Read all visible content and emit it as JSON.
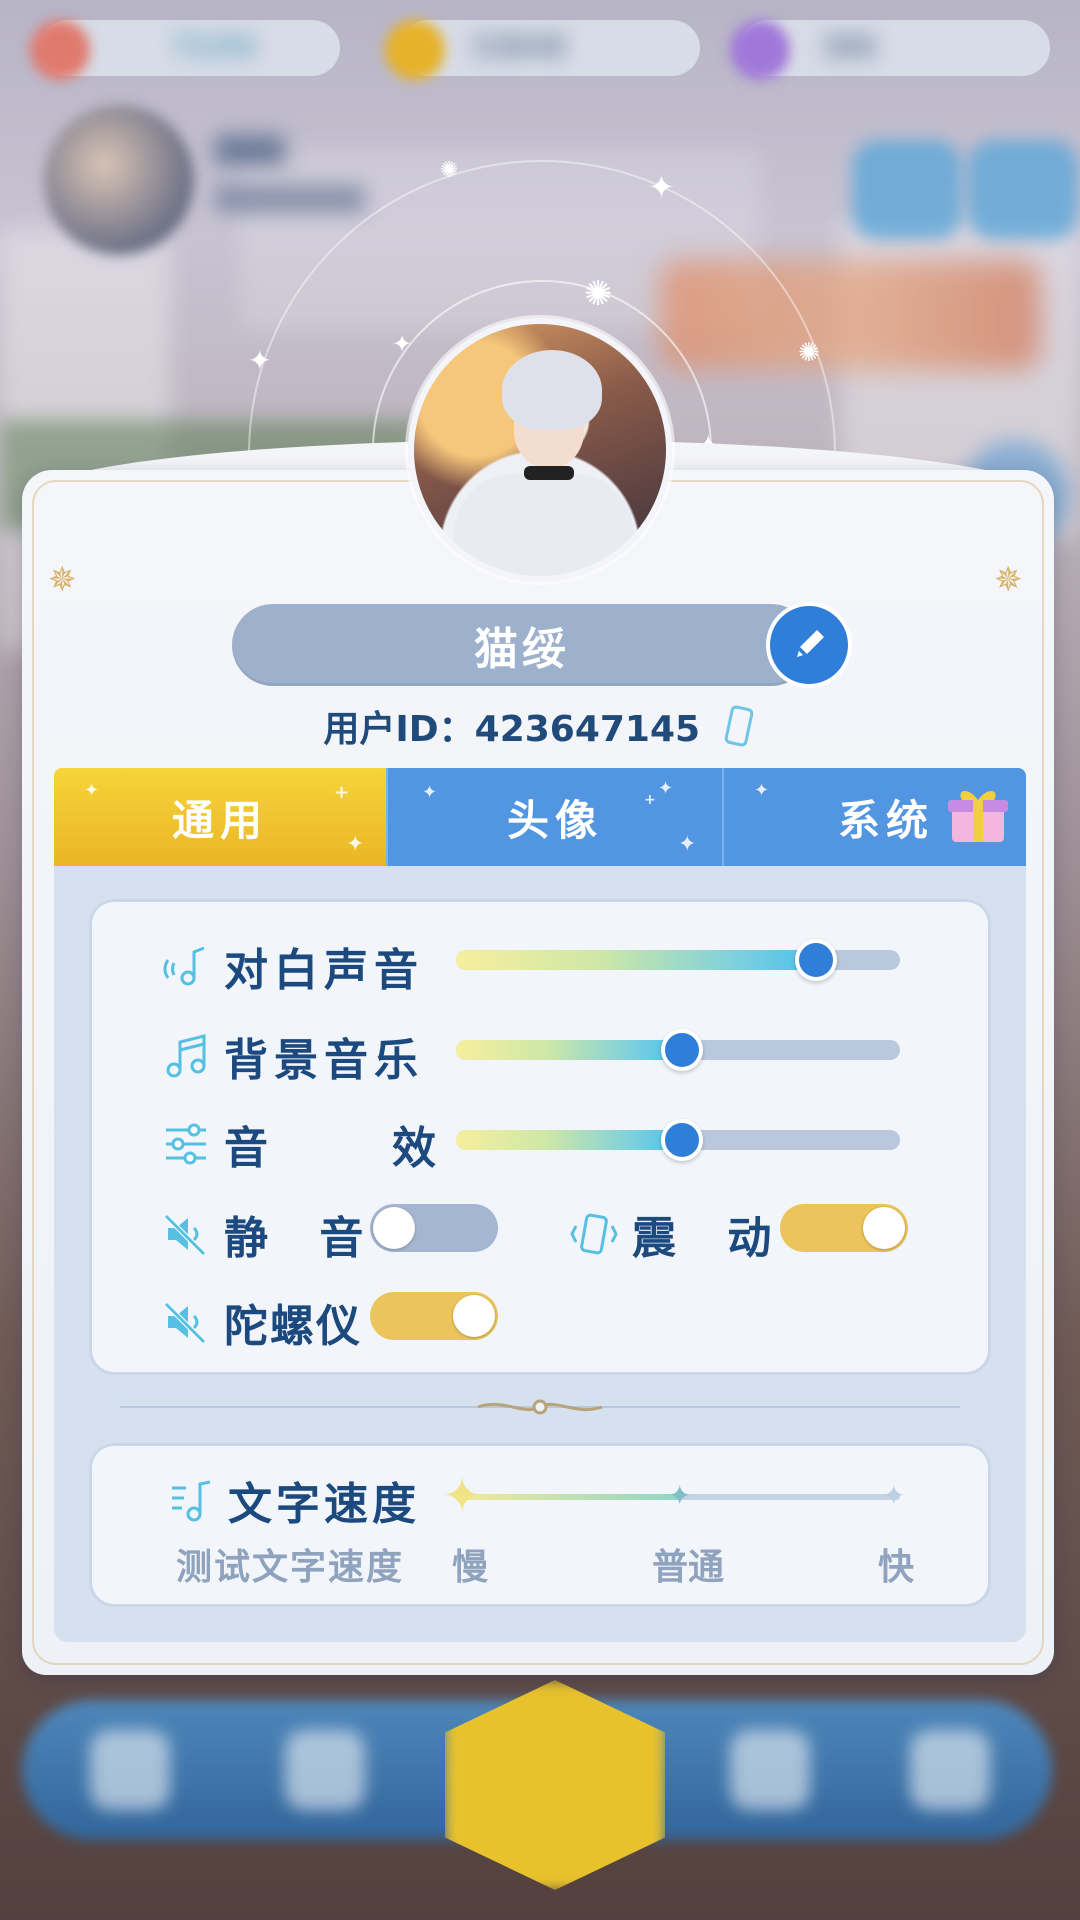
{
  "hud": {
    "currency1": "75/94",
    "currency2": "33848",
    "currency3": "386"
  },
  "profile": {
    "name": "猫绥",
    "uid_label": "用户ID：",
    "uid_value": "423647145"
  },
  "tabs": [
    {
      "label": "通用",
      "active": true
    },
    {
      "label": "头像",
      "active": false
    },
    {
      "label": "系统",
      "active": false
    }
  ],
  "audio": {
    "dialogue": {
      "label": "对白声音",
      "value": 0.81
    },
    "bgm": {
      "label": "背景音乐",
      "value": 0.51
    },
    "sfx": {
      "label": "音　效",
      "value": 0.51
    }
  },
  "toggles": {
    "mute": {
      "label": "静 音",
      "on": false
    },
    "vibrate": {
      "label": "震 动",
      "on": true
    },
    "gyro": {
      "label": "陀螺仪",
      "on": true
    }
  },
  "text_speed": {
    "label": "文字速度",
    "test_label": "测试文字速度",
    "options": [
      "慢",
      "普通",
      "快"
    ],
    "selected": "慢"
  },
  "colors": {
    "accent_blue": "#2f7fd8",
    "tab_active": "#eab625",
    "tab_inactive": "#5296e2",
    "label_text": "#1d4a7e",
    "toggle_on": "#ebc55b",
    "toggle_off": "#a4b6d1"
  }
}
